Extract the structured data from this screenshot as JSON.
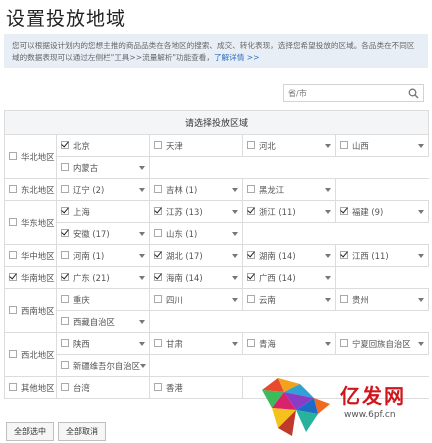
{
  "page": {
    "title": "设置投放地域",
    "info_text": "您可以根据设计划内的您想主推的商品品类在各地区的搜索、成交、转化表现，选择您希望投放的区域。各品类在不同区域的数据表现可以通过左侧栏\"工具>>流量解析\"功能查看，",
    "info_link": "了解详情 >>"
  },
  "search": {
    "placeholder": "省/市"
  },
  "table_header": "请选择投放区域",
  "regions": [
    {
      "name": "华北地区",
      "checked": false,
      "rows": [
        [
          {
            "label": "北京",
            "checked": true,
            "dd": false
          },
          {
            "label": "天津",
            "checked": false,
            "dd": false
          },
          {
            "label": "河北",
            "checked": false,
            "dd": true
          },
          {
            "label": "山西",
            "checked": false,
            "dd": true
          }
        ],
        [
          {
            "label": "内蒙古",
            "checked": false,
            "dd": true
          }
        ]
      ]
    },
    {
      "name": "东北地区",
      "checked": false,
      "rows": [
        [
          {
            "label": "辽宁 (2)",
            "checked": false,
            "dd": true
          },
          {
            "label": "吉林 (1)",
            "checked": false,
            "dd": true
          },
          {
            "label": "黑龙江",
            "checked": false,
            "dd": true
          }
        ]
      ]
    },
    {
      "name": "华东地区",
      "checked": false,
      "rows": [
        [
          {
            "label": "上海",
            "checked": true,
            "dd": false
          },
          {
            "label": "江苏 (13)",
            "checked": true,
            "dd": true
          },
          {
            "label": "浙江 (11)",
            "checked": true,
            "dd": true
          },
          {
            "label": "福建 (9)",
            "checked": true,
            "dd": true
          }
        ],
        [
          {
            "label": "安徽 (17)",
            "checked": true,
            "dd": true
          },
          {
            "label": "山东 (1)",
            "checked": false,
            "dd": true
          }
        ]
      ]
    },
    {
      "name": "华中地区",
      "checked": false,
      "rows": [
        [
          {
            "label": "河南 (1)",
            "checked": false,
            "dd": true
          },
          {
            "label": "湖北 (17)",
            "checked": true,
            "dd": true
          },
          {
            "label": "湖南 (14)",
            "checked": true,
            "dd": true
          },
          {
            "label": "江西 (11)",
            "checked": true,
            "dd": true
          }
        ]
      ]
    },
    {
      "name": "华南地区",
      "checked": true,
      "rows": [
        [
          {
            "label": "广东 (21)",
            "checked": true,
            "dd": true
          },
          {
            "label": "海南 (14)",
            "checked": true,
            "dd": true
          },
          {
            "label": "广西 (14)",
            "checked": true,
            "dd": true
          }
        ]
      ]
    },
    {
      "name": "西南地区",
      "checked": false,
      "rows": [
        [
          {
            "label": "重庆",
            "checked": false,
            "dd": false
          },
          {
            "label": "四川",
            "checked": false,
            "dd": true
          },
          {
            "label": "云南",
            "checked": false,
            "dd": true
          },
          {
            "label": "贵州",
            "checked": false,
            "dd": true
          }
        ],
        [
          {
            "label": "西藏自治区",
            "checked": false,
            "dd": true
          }
        ]
      ]
    },
    {
      "name": "西北地区",
      "checked": false,
      "rows": [
        [
          {
            "label": "陕西",
            "checked": false,
            "dd": true
          },
          {
            "label": "甘肃",
            "checked": false,
            "dd": true
          },
          {
            "label": "青海",
            "checked": false,
            "dd": true
          },
          {
            "label": "宁夏回族自治区",
            "checked": false,
            "dd": true
          }
        ],
        [
          {
            "label": "新疆维吾尔自治区",
            "checked": false,
            "dd": true
          }
        ]
      ]
    },
    {
      "name": "其他地区",
      "checked": false,
      "rows": [
        [
          {
            "label": "台湾",
            "checked": false,
            "dd": false
          },
          {
            "label": "香港",
            "checked": false,
            "dd": false
          }
        ]
      ]
    }
  ],
  "buttons": {
    "select_all": "全部选中",
    "cancel_all": "全部取消"
  },
  "watermark": {
    "brand": "亿发网",
    "url": "www.6pf.cn"
  }
}
